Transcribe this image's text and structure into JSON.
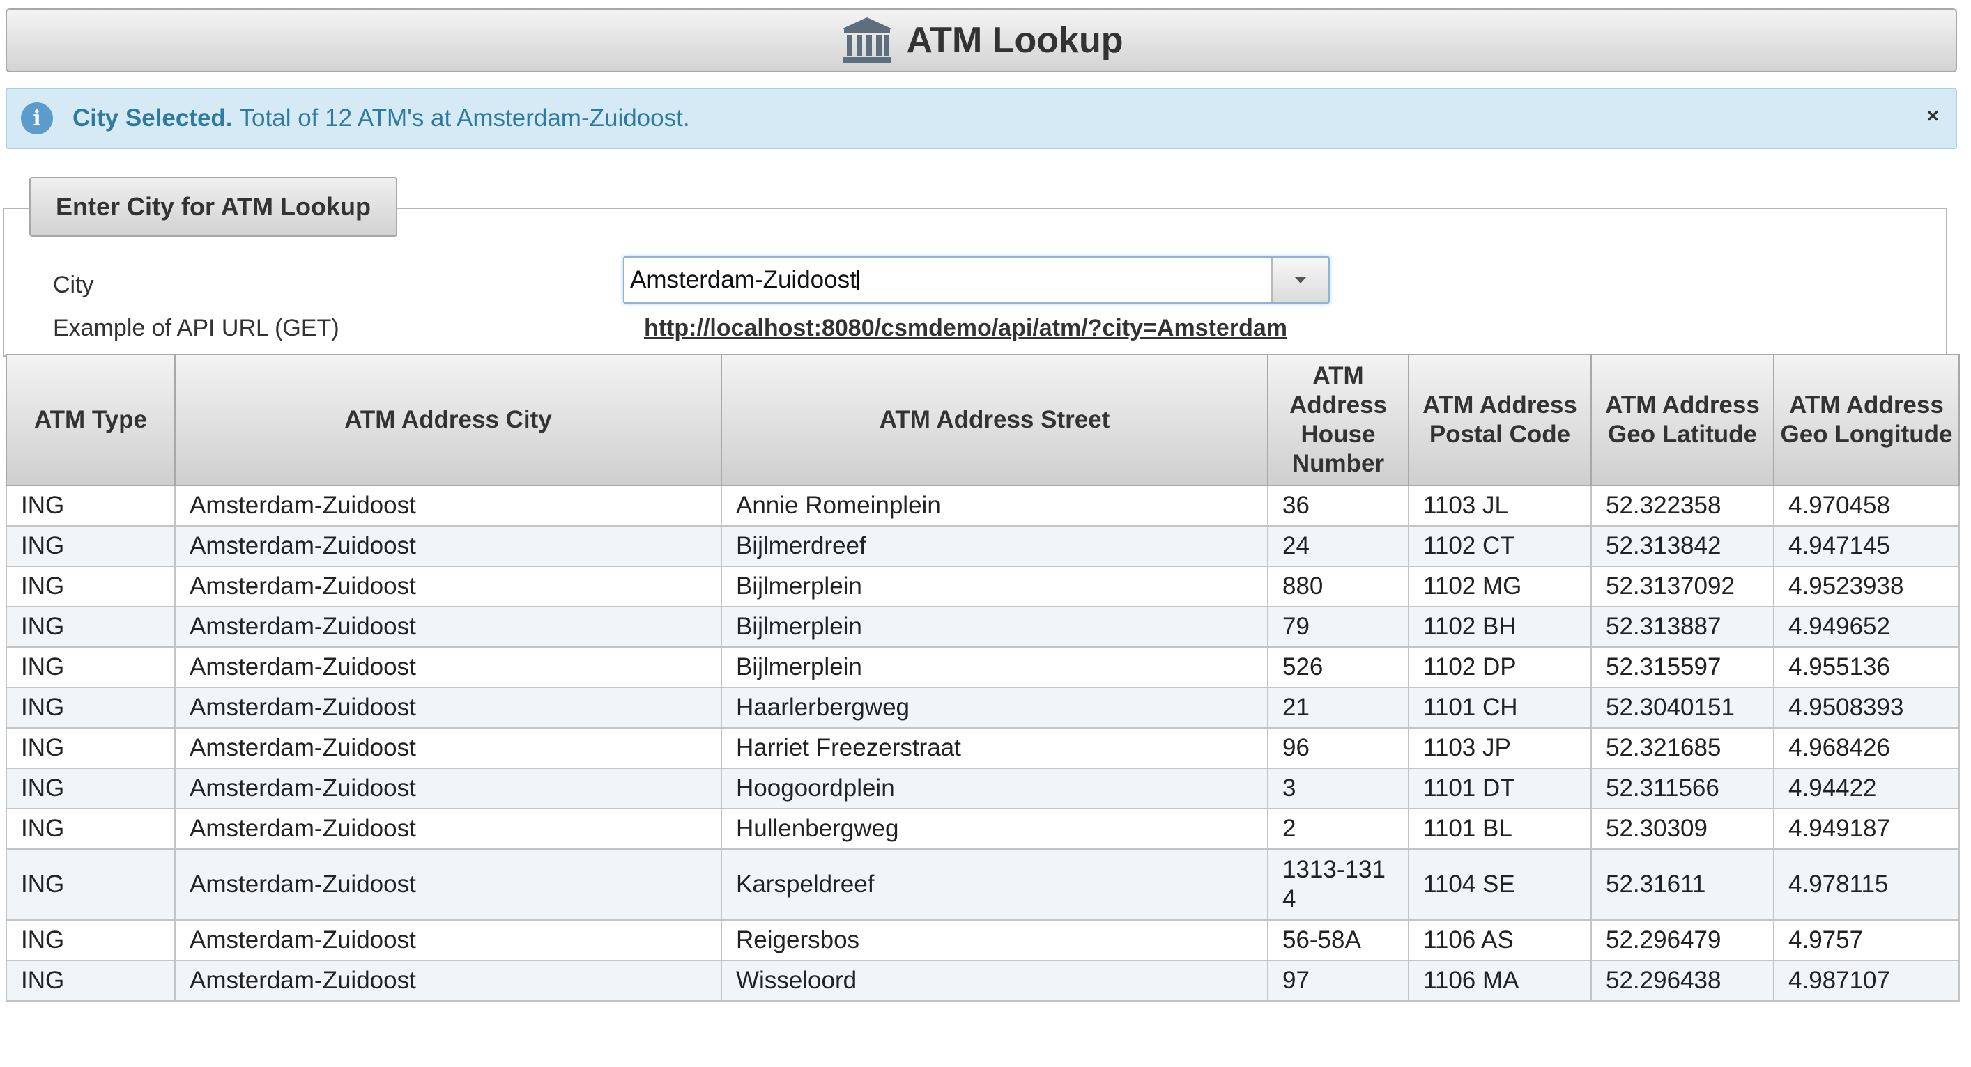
{
  "header": {
    "title": "ATM Lookup",
    "icon": "bank-icon"
  },
  "message": {
    "strong": "City Selected.",
    "text": "Total of 12 ATM's at Amsterdam-Zuidoost.",
    "close": "×"
  },
  "form": {
    "legend": "Enter City for ATM Lookup",
    "city_label": "City",
    "city_value": "Amsterdam-Zuidoost",
    "api_label": "Example of API URL (GET)",
    "api_url": "http://localhost:8080/csmdemo/api/atm/?city=Amsterdam"
  },
  "table": {
    "headers": [
      "ATM Type",
      "ATM Address City",
      "ATM Address Street",
      "ATM Address House Number",
      "ATM Address Postal Code",
      "ATM Address Geo Latitude",
      "ATM Address Geo Longitude"
    ],
    "rows": [
      [
        "ING",
        "Amsterdam-Zuidoost",
        "Annie Romeinplein",
        "36",
        "1103 JL",
        "52.322358",
        "4.970458"
      ],
      [
        "ING",
        "Amsterdam-Zuidoost",
        "Bijlmerdreef",
        "24",
        "1102 CT",
        "52.313842",
        "4.947145"
      ],
      [
        "ING",
        "Amsterdam-Zuidoost",
        "Bijlmerplein",
        "880",
        "1102 MG",
        "52.3137092",
        "4.9523938"
      ],
      [
        "ING",
        "Amsterdam-Zuidoost",
        "Bijlmerplein",
        "79",
        "1102 BH",
        "52.313887",
        "4.949652"
      ],
      [
        "ING",
        "Amsterdam-Zuidoost",
        "Bijlmerplein",
        "526",
        "1102 DP",
        "52.315597",
        "4.955136"
      ],
      [
        "ING",
        "Amsterdam-Zuidoost",
        "Haarlerbergweg",
        "21",
        "1101 CH",
        "52.3040151",
        "4.9508393"
      ],
      [
        "ING",
        "Amsterdam-Zuidoost",
        "Harriet Freezerstraat",
        "96",
        "1103 JP",
        "52.321685",
        "4.968426"
      ],
      [
        "ING",
        "Amsterdam-Zuidoost",
        "Hoogoordplein",
        "3",
        "1101 DT",
        "52.311566",
        "4.94422"
      ],
      [
        "ING",
        "Amsterdam-Zuidoost",
        "Hullenbergweg",
        "2",
        "1101 BL",
        "52.30309",
        "4.949187"
      ],
      [
        "ING",
        "Amsterdam-Zuidoost",
        "Karspeldreef",
        "1313-1314",
        "1104 SE",
        "52.31611",
        "4.978115"
      ],
      [
        "ING",
        "Amsterdam-Zuidoost",
        "Reigersbos",
        "56-58A",
        "1106 AS",
        "52.296479",
        "4.9757"
      ],
      [
        "ING",
        "Amsterdam-Zuidoost",
        "Wisseloord",
        "97",
        "1106 MA",
        "52.296438",
        "4.987107"
      ]
    ]
  }
}
